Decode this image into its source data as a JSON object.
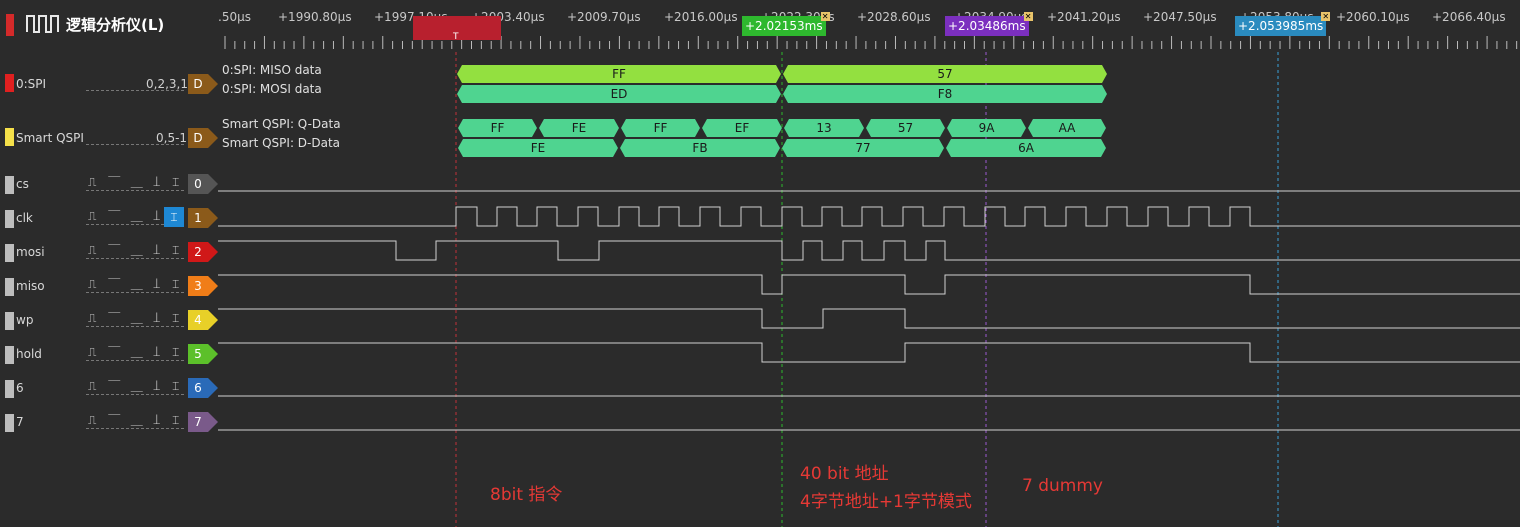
{
  "title": "逻辑分析仪(L)",
  "ruler_labels": [
    ".50µs",
    "+1990.80µs",
    "+1997.10µs",
    "+2003.40µs",
    "+2009.70µs",
    "+2016.00µs",
    "+2022.30µs",
    "+2028.60µs",
    "+2034.90µs",
    "+2041.20µs",
    "+2047.50µs",
    "+2053.80µs",
    "+2060.10µs",
    "+2066.40µs"
  ],
  "markers": [
    {
      "label": "T",
      "color": "#c0303a"
    },
    {
      "label": "+2.02153ms",
      "color": "#2eb82e"
    },
    {
      "label": "+2.03486ms",
      "color": "#7b2fbf"
    },
    {
      "label": "+2.053985ms",
      "color": "#2a8bbf"
    }
  ],
  "channels": [
    {
      "name": "0:SPI",
      "bits": "0,2,3,1",
      "badge": "D",
      "color": "#e02020",
      "badge_color": "#8b5a1a",
      "lines": [
        "0:SPI: MISO data",
        "0:SPI: MOSI data"
      ]
    },
    {
      "name": "Smart QSPI",
      "bits": "0,5-1",
      "badge": "D",
      "color": "#f5e04a",
      "badge_color": "#8b5a1a",
      "lines": [
        "Smart QSPI: Q-Data",
        "Smart QSPI: D-Data"
      ]
    },
    {
      "name": "cs",
      "badge": "0",
      "color": "#cccccc",
      "badge_color": "#555555"
    },
    {
      "name": "clk",
      "badge": "1",
      "color": "#cccccc",
      "badge_color": "#8b5a1a"
    },
    {
      "name": "mosi",
      "badge": "2",
      "color": "#cccccc",
      "badge_color": "#d01818"
    },
    {
      "name": "miso",
      "badge": "3",
      "color": "#cccccc",
      "badge_color": "#f07d18"
    },
    {
      "name": "wp",
      "badge": "4",
      "color": "#cccccc",
      "badge_color": "#e8d028"
    },
    {
      "name": "hold",
      "badge": "5",
      "color": "#cccccc",
      "badge_color": "#5cc02a"
    },
    {
      "name": "6",
      "badge": "6",
      "color": "#cccccc",
      "badge_color": "#2a6ab8"
    },
    {
      "name": "7",
      "badge": "7",
      "color": "#cccccc",
      "badge_color": "#7a5a8a"
    }
  ],
  "trigger_glyphs": "⎍ ⎺ ⎽ ⟘ ⌶",
  "protocol": {
    "miso": [
      "FF",
      "57"
    ],
    "mosi": [
      "ED",
      "F8"
    ],
    "qdata": [
      "FF",
      "FE",
      "FF",
      "EF",
      "13",
      "57",
      "9A",
      "AA"
    ],
    "ddata": [
      "FE",
      "FB",
      "77",
      "6A"
    ]
  },
  "annotations": {
    "a1": "8bit 指令",
    "a2": "40 bit 地址",
    "a3": "4字节地址+1字节模式",
    "a4": "7 dummy"
  }
}
